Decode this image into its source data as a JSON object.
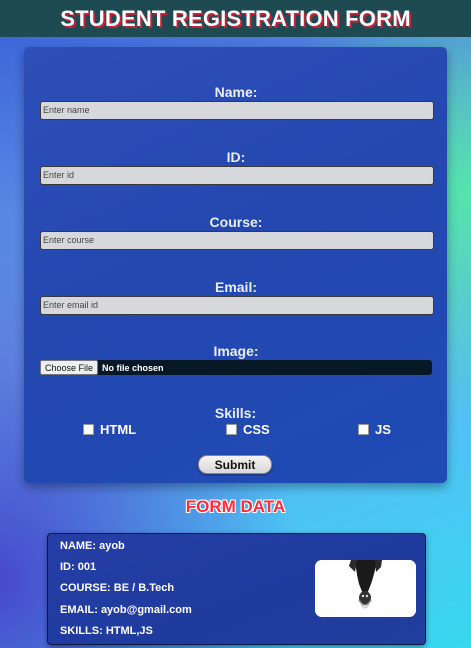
{
  "header": {
    "title": "STUDENT REGISTRATION FORM"
  },
  "form": {
    "name": {
      "label": "Name:",
      "placeholder": "Enter name"
    },
    "id": {
      "label": "ID:",
      "placeholder": "Enter id"
    },
    "course": {
      "label": "Course:",
      "placeholder": "Enter course"
    },
    "email": {
      "label": "Email:",
      "placeholder": "Enter email id"
    },
    "image": {
      "label": "Image:",
      "button": "Choose File",
      "status": "No file chosen"
    },
    "skills": {
      "label": "Skills:",
      "options": [
        {
          "label": "HTML",
          "checked": false
        },
        {
          "label": "CSS",
          "checked": false
        },
        {
          "label": "JS",
          "checked": false
        }
      ]
    },
    "submit_label": "Submit"
  },
  "form_data": {
    "heading": "FORM DATA",
    "name_line": "NAME: ayob",
    "id_line": "ID: 001",
    "course_line": "COURSE: BE / B.Tech",
    "email_line": "EMAIL: ayob@gmail.com",
    "skills_line": "SKILLS: HTML,JS"
  },
  "colors": {
    "header_bg": "#1e4a52",
    "card_bg": "#2447b0",
    "heading_red": "#ff2a3c",
    "file_bar": "#061826"
  }
}
